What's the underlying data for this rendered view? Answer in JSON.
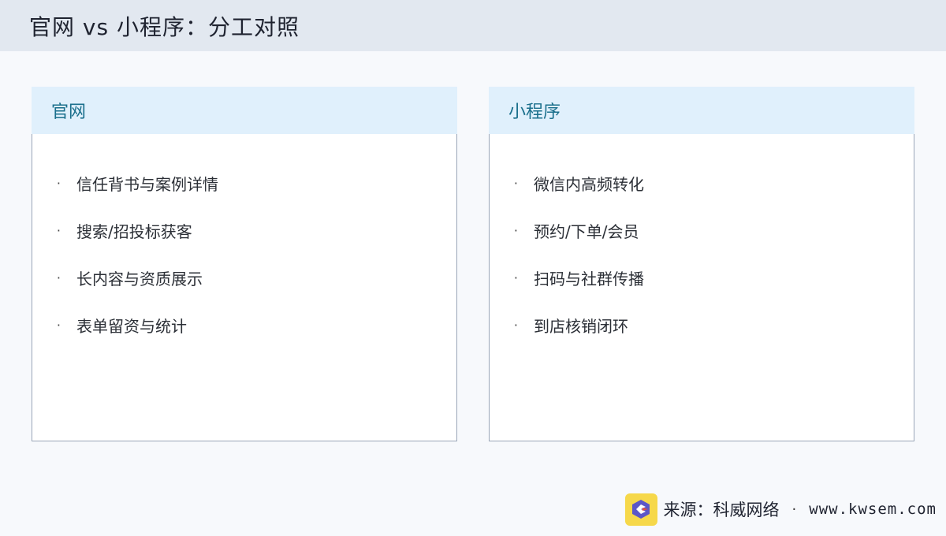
{
  "header": {
    "title": "官网 vs 小程序：分工对照"
  },
  "panels": [
    {
      "title": "官网",
      "items": [
        "信任背书与案例详情",
        "搜索/招投标获客",
        "长内容与资质展示",
        "表单留资与统计"
      ]
    },
    {
      "title": "小程序",
      "items": [
        "微信内高频转化",
        "预约/下单/会员",
        "扫码与社群传播",
        "到店核销闭环"
      ]
    }
  ],
  "bullet": "·",
  "footer": {
    "source": "来源：科威网络",
    "separator": "·",
    "website": "www.kwsem.com",
    "logo_icon": "kwsem-logo-icon"
  },
  "colors": {
    "header_bg": "#e2e8f0",
    "panel_head_bg": "#e0f0fc",
    "panel_title": "#1a6f8c",
    "logo_bg": "#f6d84a",
    "logo_mark": "#5b56c8",
    "logo_accent": "#e24c3f"
  }
}
